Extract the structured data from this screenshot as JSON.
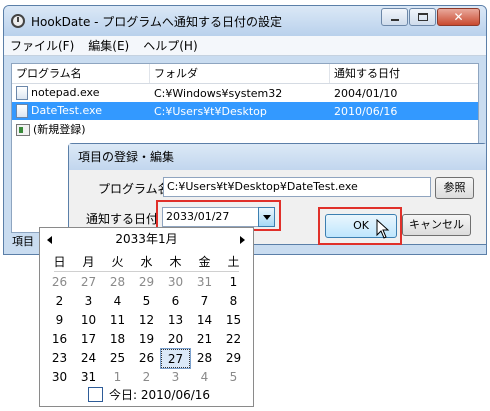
{
  "window": {
    "title": "HookDate  - プログラムへ通知する日付の設定",
    "menu": [
      "ファイル(F)",
      "編集(E)",
      "ヘルプ(H)"
    ]
  },
  "list": {
    "columns": [
      "プログラム名",
      "フォルダ",
      "通知する日付"
    ],
    "rows": [
      {
        "name": "notepad.exe",
        "folder": "C:¥Windows¥system32",
        "date": "2004/01/10"
      },
      {
        "name": "DateTest.exe",
        "folder": "C:¥Users¥t¥Desktop",
        "date": "2010/06/16"
      }
    ],
    "new_entry": "(新規登録)"
  },
  "status_label": "項目",
  "dialog": {
    "title": "項目の登録・編集",
    "program_label": "プログラム名",
    "program_value": "C:¥Users¥t¥Desktop¥DateTest.exe",
    "browse_button": "参照",
    "date_label": "通知する日付",
    "date_value": "2033/01/27",
    "ok_button": "OK",
    "cancel_button": "キャンセル"
  },
  "calendar": {
    "month_label": "2033年1月",
    "weekdays": [
      "日",
      "月",
      "火",
      "水",
      "木",
      "金",
      "土"
    ],
    "weeks": [
      [
        "26",
        "27",
        "28",
        "29",
        "30",
        "31",
        "1"
      ],
      [
        "2",
        "3",
        "4",
        "5",
        "6",
        "7",
        "8"
      ],
      [
        "9",
        "10",
        "11",
        "12",
        "13",
        "14",
        "15"
      ],
      [
        "16",
        "17",
        "18",
        "19",
        "20",
        "21",
        "22"
      ],
      [
        "23",
        "24",
        "25",
        "26",
        "27",
        "28",
        "29"
      ],
      [
        "30",
        "31",
        "1",
        "2",
        "3",
        "4",
        "5"
      ]
    ],
    "selected_day": "27",
    "today_label": "今日: 2010/06/16"
  },
  "colors": {
    "selection": "#3399ff",
    "highlight": "#e0302a"
  }
}
